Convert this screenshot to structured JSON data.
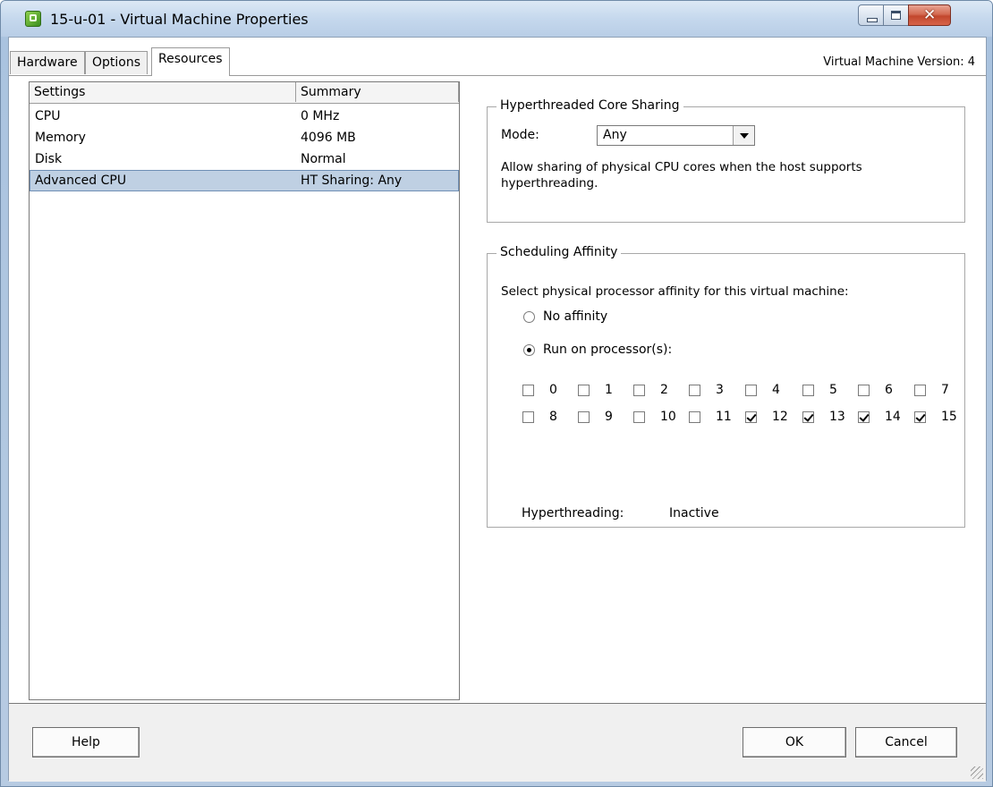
{
  "window": {
    "title": "15-u-01 - Virtual Machine Properties",
    "icon": "vsphere-vm-icon"
  },
  "tabs": [
    {
      "label": "Hardware"
    },
    {
      "label": "Options"
    },
    {
      "label": "Resources"
    }
  ],
  "active_tab": "Resources",
  "vm_version": "Virtual Machine Version: 4",
  "settings_list": {
    "headers": [
      "Settings",
      "Summary"
    ],
    "rows": [
      {
        "setting": "CPU",
        "summary": "0 MHz"
      },
      {
        "setting": "Memory",
        "summary": "4096 MB"
      },
      {
        "setting": "Disk",
        "summary": "Normal"
      },
      {
        "setting": "Advanced CPU",
        "summary": "HT Sharing: Any"
      }
    ],
    "selected_row": "Advanced CPU"
  },
  "ht_sharing": {
    "legend": "Hyperthreaded Core Sharing",
    "mode_label": "Mode:",
    "mode_value": "Any",
    "description": "Allow sharing of physical CPU cores when the host supports hyperthreading."
  },
  "affinity": {
    "legend": "Scheduling Affinity",
    "prompt": "Select physical processor affinity for this virtual machine:",
    "no_affinity_label": "No affinity",
    "run_on_label": "Run on processor(s):",
    "selected_option": "Run on processor(s):",
    "processors": [
      {
        "id": "0",
        "checked": false
      },
      {
        "id": "1",
        "checked": false
      },
      {
        "id": "2",
        "checked": false
      },
      {
        "id": "3",
        "checked": false
      },
      {
        "id": "4",
        "checked": false
      },
      {
        "id": "5",
        "checked": false
      },
      {
        "id": "6",
        "checked": false
      },
      {
        "id": "7",
        "checked": false
      },
      {
        "id": "8",
        "checked": false
      },
      {
        "id": "9",
        "checked": false
      },
      {
        "id": "10",
        "checked": false
      },
      {
        "id": "11",
        "checked": false
      },
      {
        "id": "12",
        "checked": true
      },
      {
        "id": "13",
        "checked": true
      },
      {
        "id": "14",
        "checked": true
      },
      {
        "id": "15",
        "checked": true
      }
    ],
    "hyperthreading_label": "Hyperthreading:",
    "hyperthreading_value": "Inactive"
  },
  "buttons": {
    "help": "Help",
    "ok": "OK",
    "cancel": "Cancel"
  }
}
